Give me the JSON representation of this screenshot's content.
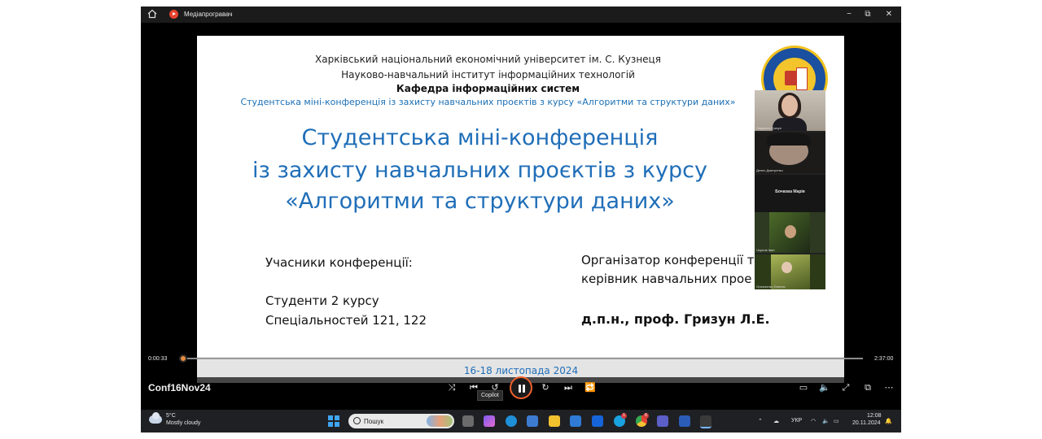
{
  "window": {
    "title": "Медіапрогравач",
    "buttons": {
      "minimize": "−",
      "restore": "⧉",
      "close": "✕"
    }
  },
  "slide": {
    "header": [
      "Харківський національний економічний університет ім. С. Кузнеця",
      "Науково-навчальний інститут інформаційних технологій",
      "Кафедра інформаційних систем",
      "Студентська міні-конференція із захисту навчальних проєктів з курсу «Алгоритми та структури даних»"
    ],
    "title_lines": [
      "Студентська міні-конференція",
      "із захисту навчальних проєктів з курсу",
      "«Алгоритми та структури даних»"
    ],
    "left_label": "Учасники конференції:",
    "left_lines": [
      "Студенти 2 курсу",
      "Спеціальностей 121, 122"
    ],
    "right_label_1": "Організатор конференції т",
    "right_label_2": "керівник навчальних прое",
    "right_name": "д.п.н., проф. Гризун Л.Е."
  },
  "participants": [
    {
      "name": "Людмила Гризун"
    },
    {
      "name": "Денис Дмитренко"
    },
    {
      "name": "Бочкова Марія"
    },
    {
      "name": "Чорнов Іван"
    },
    {
      "name": "Олексієнко Євгенія"
    }
  ],
  "player": {
    "current_time": "0:00:33",
    "total_time": "2:37:00",
    "progress_fraction": 0.0035,
    "subtitle": "16-18 листопада 2024",
    "media_title": "Conf16Nov24",
    "tooltip": "Copilot",
    "accent_color": "#e88a3c"
  },
  "taskbar": {
    "temperature": "5°C",
    "weather": "Mostly cloudy",
    "search_placeholder": "Пошук",
    "language": "УКР",
    "time": "12:08",
    "date": "20.11.2024",
    "notification_badge_1": "1",
    "notification_badge_2": "6"
  }
}
